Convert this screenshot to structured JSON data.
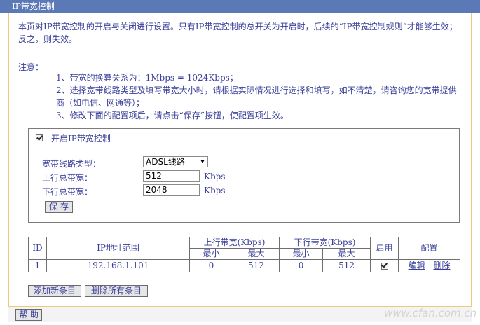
{
  "title": "IP带宽控制",
  "description": "本页对IP带宽控制的开启与关闭进行设置。只有IP带宽控制的总开关为开启时，后续的“IP带宽控制规则”才能够生效；反之，则失效。",
  "notes": {
    "title": "注意：",
    "items": [
      "1、带宽的换算关系为：1Mbps = 1024Kbps；",
      "2、选择宽带线路类型及填写带宽大小时，请根据实际情况进行选择和填写，如不清楚，请咨询您的宽带提供商（如电信、网通等）；",
      "3、修改下面的配置项后，请点击“保存”按钮，使配置项生效。"
    ]
  },
  "settings": {
    "enable_label": "开启IP带宽控制",
    "enable_checked": true,
    "line_type_label": "宽带线路类型：",
    "line_type_value": "ADSL线路",
    "upload_label": "上行总带宽：",
    "upload_value": "512",
    "download_label": "下行总带宽：",
    "download_value": "2048",
    "unit": "Kbps",
    "save_label": "保 存"
  },
  "rules_table": {
    "headers": {
      "id": "ID",
      "ip_range": "IP地址范围",
      "up_bw": "上行带宽(Kbps)",
      "down_bw": "下行带宽(Kbps)",
      "min": "最小",
      "max": "最大",
      "enabled": "启用",
      "config": "配置"
    },
    "rows": [
      {
        "id": "1",
        "ip_range": "192.168.1.101",
        "up_min": "0",
        "up_max": "512",
        "down_min": "0",
        "down_max": "512",
        "enabled": true,
        "edit": "编辑",
        "delete": "删除"
      }
    ]
  },
  "actions": {
    "add_new": "添加新条目",
    "delete_all": "删除所有条目"
  },
  "help_label": "帮 助",
  "watermark": "www.cfan.com.cn"
}
